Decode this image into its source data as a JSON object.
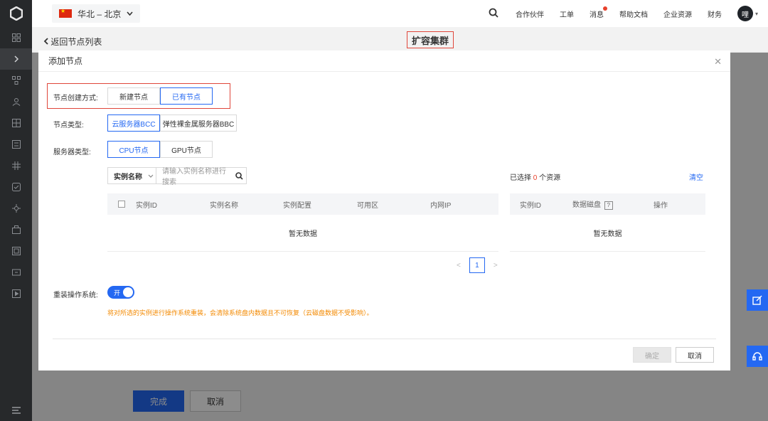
{
  "header": {
    "region": "华北 – 北京",
    "links": [
      "合作伙伴",
      "工单",
      "消息",
      "帮助文档",
      "企业资源",
      "财务"
    ],
    "avatar_text": "哩"
  },
  "subheader": {
    "back_label": "返回节点列表",
    "title": "扩容集群"
  },
  "page_footer": {
    "done_label": "完成",
    "cancel_label": "取消"
  },
  "modal": {
    "title": "添加节点",
    "create_method": {
      "label": "节点创建方式:",
      "options": [
        "新建节点",
        "已有节点"
      ],
      "selected": "已有节点"
    },
    "node_type": {
      "label": "节点类型:",
      "options": [
        "云服务器BCC",
        "弹性裸金属服务器BBC"
      ],
      "selected": "云服务器BCC"
    },
    "server_type": {
      "label": "服务器类型:",
      "options": [
        "CPU节点",
        "GPU节点"
      ],
      "selected": "CPU节点"
    },
    "search": {
      "field": "实例名称",
      "placeholder": "请输入实例名称进行搜索"
    },
    "selected_prefix": "已选择",
    "selected_count": "0",
    "selected_suffix": "个资源",
    "clear_label": "清空",
    "left_table": {
      "columns": [
        "实例ID",
        "实例名称",
        "实例配置",
        "可用区",
        "内网IP"
      ],
      "empty_text": "暂无数据"
    },
    "right_table": {
      "columns": [
        "实例ID",
        "数据磁盘",
        "操作"
      ],
      "help_mark": "?",
      "empty_text": "暂无数据"
    },
    "pagination": {
      "current_page": "1",
      "prev": "<",
      "next": ">"
    },
    "reinstall": {
      "label": "重装操作系统:",
      "toggle_text": "开",
      "warning": "将对所选的实例进行操作系统重装，会清除系统盘内数据且不可恢复（云磁盘数据不受影响）。"
    },
    "confirm_label": "确定",
    "cancel_label": "取消"
  },
  "colors": {
    "primary": "#2468f2",
    "highlight": "#e0463a",
    "warning": "#f38900",
    "sidebar": "#27292b"
  }
}
